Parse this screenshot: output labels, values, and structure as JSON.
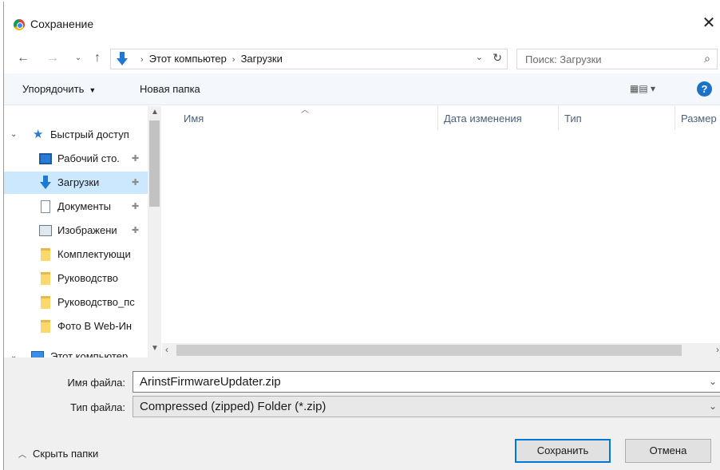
{
  "window": {
    "title": "Сохранение",
    "close_glyph": "✕"
  },
  "nav": {
    "back": "←",
    "forward": "→",
    "recent": "⌄",
    "up": "↑",
    "breadcrumb": [
      "Этот компьютер",
      "Загрузки"
    ],
    "separator": "›",
    "dropdown": "⌄",
    "refresh": "↻"
  },
  "search": {
    "placeholder": "Поиск: Загрузки",
    "icon": "⌕"
  },
  "toolbar": {
    "organize": "Упорядочить",
    "new_folder": "Новая папка",
    "view": "▦▤ ▾",
    "help": "?"
  },
  "tree": {
    "quick_access": "Быстрый доступ",
    "items": [
      {
        "label": "Рабочий сто.",
        "icon": "desktop-icon",
        "pinned": true
      },
      {
        "label": "Загрузки",
        "icon": "downloads-icon",
        "pinned": true,
        "selected": true
      },
      {
        "label": "Документы",
        "icon": "documents-icon",
        "pinned": true
      },
      {
        "label": "Изображени",
        "icon": "images-icon",
        "pinned": true
      },
      {
        "label": "Комплектующи",
        "icon": "folder-icon",
        "pinned": false
      },
      {
        "label": "Руководство",
        "icon": "folder-icon",
        "pinned": false
      },
      {
        "label": "Руководство_пс",
        "icon": "folder-icon",
        "pinned": false
      },
      {
        "label": "Фото В Web-Ин",
        "icon": "folder-icon",
        "pinned": false
      }
    ],
    "this_pc": "Этот компьютер",
    "pin_glyph": "✚"
  },
  "columns": [
    "Имя",
    "Дата изменения",
    "Тип",
    "Размер"
  ],
  "form": {
    "filename_label": "Имя файла:",
    "filename_value": "ArinstFirmwareUpdater.zip",
    "filetype_label": "Тип файла:",
    "filetype_value": "Compressed (zipped) Folder (*.zip)"
  },
  "footer": {
    "hide_folders": "Скрыть папки",
    "save": "Сохранить",
    "cancel": "Отмена"
  },
  "colors": {
    "accent": "#0078d7",
    "selection": "#cce8ff",
    "help": "#1a73c8"
  }
}
